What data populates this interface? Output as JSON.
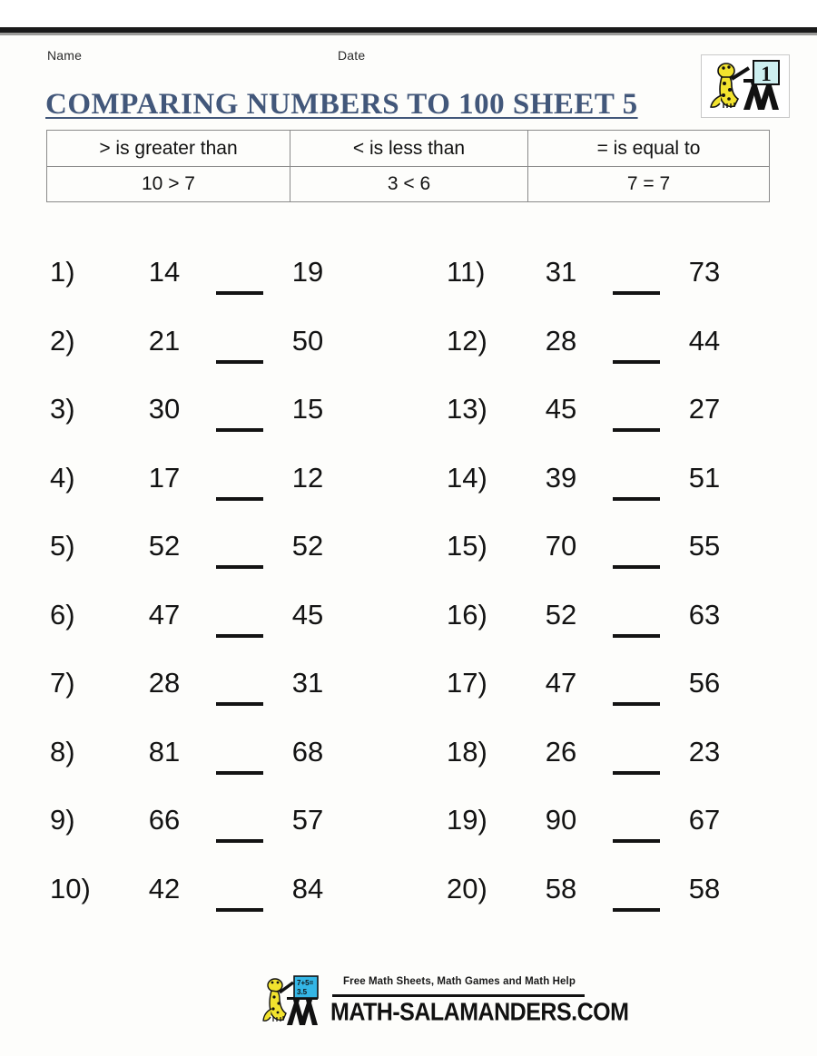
{
  "page": {
    "name_label": "Name",
    "date_label": "Date",
    "title": "COMPARING NUMBERS TO 100 SHEET 5",
    "title_color": "#42577a"
  },
  "logo_badge": {
    "name": "math-salamanders-grade-badge",
    "grade_number": "1"
  },
  "legend": {
    "headers": [
      "> is greater than",
      "< is less than",
      "= is equal to"
    ],
    "examples": [
      "10 > 7",
      "3 < 6",
      "7 = 7"
    ]
  },
  "problems": {
    "left_column": [
      {
        "num": "1)",
        "a": "14",
        "blank": "__",
        "b": "19"
      },
      {
        "num": "2)",
        "a": "21",
        "blank": "__",
        "b": "50"
      },
      {
        "num": "3)",
        "a": "30",
        "blank": "__",
        "b": "15"
      },
      {
        "num": "4)",
        "a": "17",
        "blank": "__",
        "b": "12"
      },
      {
        "num": "5)",
        "a": "52",
        "blank": "__",
        "b": "52"
      },
      {
        "num": "6)",
        "a": "47",
        "blank": "__",
        "b": "45"
      },
      {
        "num": "7)",
        "a": "28",
        "blank": "__",
        "b": "31"
      },
      {
        "num": "8)",
        "a": "81",
        "blank": "__",
        "b": "68"
      },
      {
        "num": "9)",
        "a": "66",
        "blank": "__",
        "b": "57"
      },
      {
        "num": "10)",
        "a": "42",
        "blank": "__",
        "b": "84"
      }
    ],
    "right_column": [
      {
        "num": "11)",
        "a": "31",
        "blank": "__",
        "b": "73"
      },
      {
        "num": "12)",
        "a": "28",
        "blank": "__",
        "b": "44"
      },
      {
        "num": "13)",
        "a": "45",
        "blank": "__",
        "b": "27"
      },
      {
        "num": "14)",
        "a": "39",
        "blank": "__",
        "b": "51"
      },
      {
        "num": "15)",
        "a": "70",
        "blank": "__",
        "b": "55"
      },
      {
        "num": "16)",
        "a": "52",
        "blank": "__",
        "b": "63"
      },
      {
        "num": "17)",
        "a": "47",
        "blank": "__",
        "b": "56"
      },
      {
        "num": "18)",
        "a": "26",
        "blank": "__",
        "b": "23"
      },
      {
        "num": "19)",
        "a": "90",
        "blank": "__",
        "b": "67"
      },
      {
        "num": "20)",
        "a": "58",
        "blank": "__",
        "b": "58"
      }
    ]
  },
  "footer": {
    "tagline": "Free Math Sheets, Math Games and Math Help",
    "domain": "MATH-SALAMANDERS.COM"
  }
}
